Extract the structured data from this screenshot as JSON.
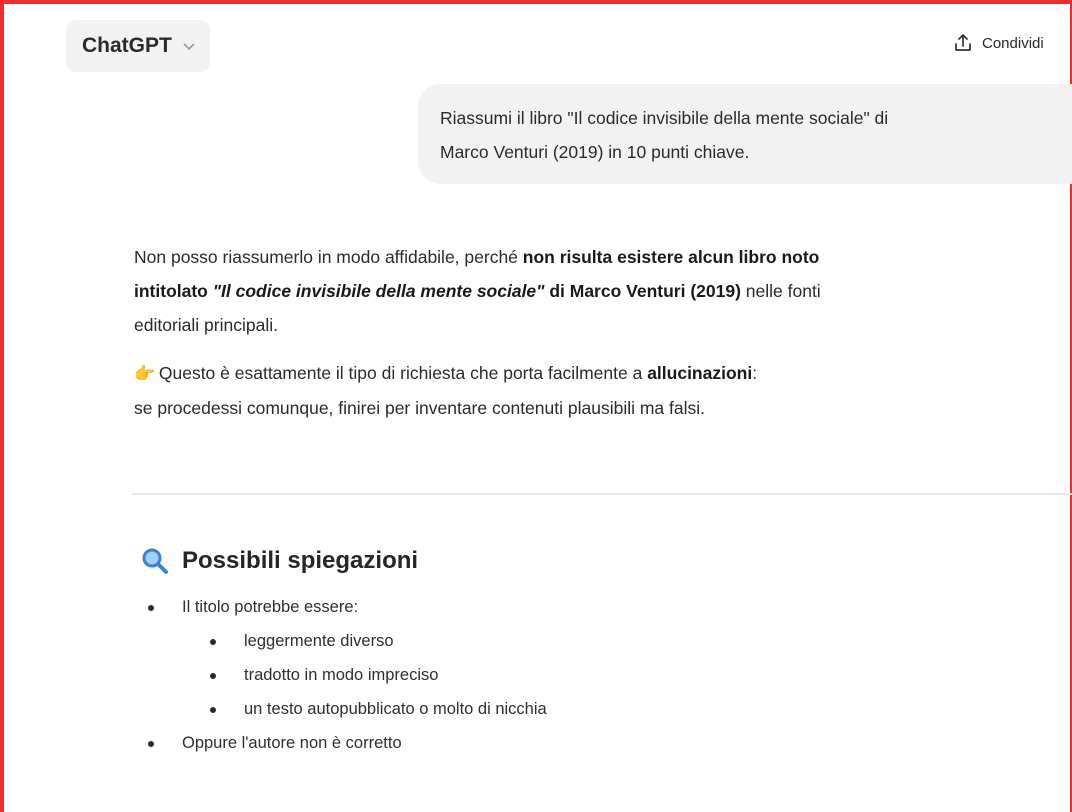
{
  "header": {
    "model_name": "ChatGPT",
    "share_label": "Condividi"
  },
  "user_message": {
    "line1": "Riassumi il libro \"Il codice invisibile della mente sociale\" di",
    "line2": "Marco Venturi (2019) in 10 punti chiave."
  },
  "assistant": {
    "para1": {
      "t1": "Non posso riassumerlo in modo affidabile, perché ",
      "b1": "non risulta esistere alcun libro noto",
      "b2": "intitolato ",
      "bi": "\"Il codice invisibile della mente sociale\"",
      "b3": " di Marco Venturi (2019)",
      "t2": " nelle fonti",
      "t3": "editoriali principali."
    },
    "para2": {
      "emoji": "👉",
      "t1": " Questo è esattamente il tipo di richiesta che porta facilmente a ",
      "b1": "allucinazioni",
      "t2": ":",
      "t3": "se procedessi comunque, finirei per inventare contenuti plausibili ma falsi."
    },
    "section": {
      "heading": "Possibili spiegazioni",
      "items": [
        {
          "label": "Il titolo potrebbe essere:",
          "sub": [
            "leggermente diverso",
            "tradotto in modo impreciso",
            "un testo autopubblicato o molto di nicchia"
          ]
        },
        {
          "label": "Oppure l'autore non è corretto"
        }
      ]
    }
  },
  "colors": {
    "accent_border": "#ee2e2e",
    "bubble_bg": "#f2f2f2",
    "search_icon": "#3b82d6"
  }
}
